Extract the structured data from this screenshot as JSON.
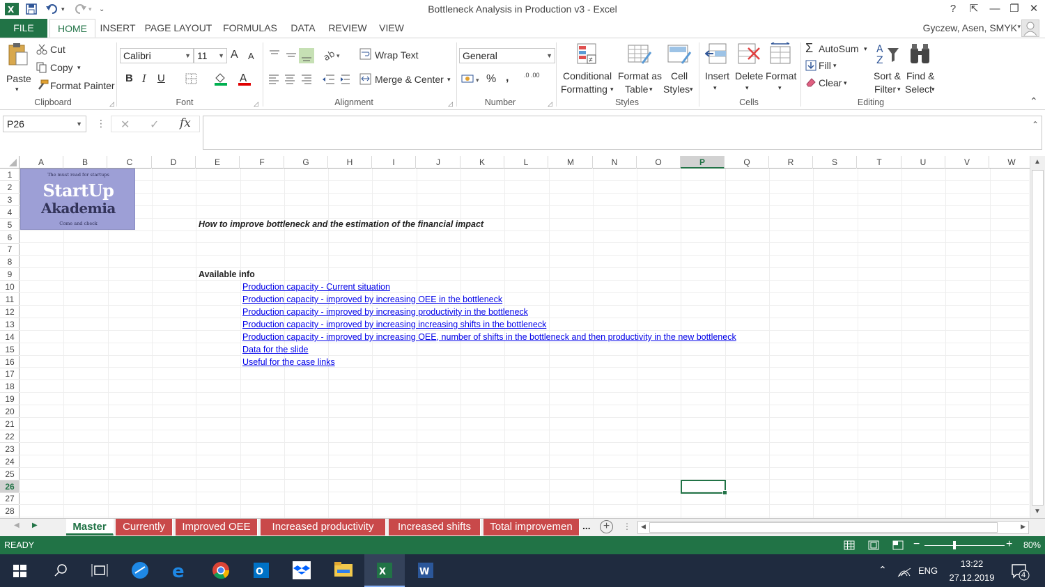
{
  "window": {
    "title": "Bottleneck Analysis in Production v3 - Excel",
    "help": "?",
    "ribbon_toggle": "⇱",
    "minimize": "—",
    "restore": "❐",
    "close": "✕"
  },
  "tabs": [
    "FILE",
    "HOME",
    "INSERT",
    "PAGE LAYOUT",
    "FORMULAS",
    "DATA",
    "REVIEW",
    "VIEW"
  ],
  "user": "Gyczew, Asen, SMYK",
  "ribbon": {
    "clipboard": {
      "paste": "Paste",
      "cut": "Cut",
      "copy": "Copy",
      "format_painter": "Format Painter",
      "label": "Clipboard"
    },
    "font": {
      "name": "Calibri",
      "size": "11",
      "bold": "B",
      "italic": "I",
      "underline": "U",
      "grow": "A",
      "shrink": "A",
      "label": "Font"
    },
    "alignment": {
      "wrap": "Wrap Text",
      "merge": "Merge & Center",
      "label": "Alignment"
    },
    "number": {
      "format": "General",
      "percent": "%",
      "comma": ",",
      "inc_dec": ".0 .00",
      "label": "Number"
    },
    "styles": {
      "conditional1": "Conditional",
      "conditional2": "Formatting",
      "format_as1": "Format as",
      "format_as2": "Table",
      "cell_styles1": "Cell",
      "cell_styles2": "Styles",
      "label": "Styles"
    },
    "cells": {
      "insert": "Insert",
      "delete": "Delete",
      "format": "Format",
      "label": "Cells"
    },
    "editing": {
      "autosum": "AutoSum",
      "fill": "Fill",
      "clear": "Clear",
      "sort1": "Sort &",
      "sort2": "Filter",
      "find1": "Find &",
      "find2": "Select",
      "label": "Editing"
    }
  },
  "formula_bar": {
    "name_box": "P26",
    "fx": "fx",
    "cancel": "✕",
    "enter": "✓",
    "content": ""
  },
  "columns": [
    "A",
    "B",
    "C",
    "D",
    "E",
    "F",
    "G",
    "H",
    "I",
    "J",
    "K",
    "L",
    "M",
    "N",
    "O",
    "P",
    "Q",
    "R",
    "S",
    "T",
    "U",
    "V",
    "W"
  ],
  "selected_column": "P",
  "rows": [
    "1",
    "2",
    "3",
    "4",
    "5",
    "6",
    "7",
    "8",
    "9",
    "10",
    "11",
    "12",
    "13",
    "14",
    "15",
    "16",
    "17",
    "18",
    "19",
    "20",
    "21",
    "22",
    "23",
    "24",
    "25",
    "26",
    "27",
    "28"
  ],
  "selected_row": "26",
  "logo": {
    "tagline_top": "The must read for startups",
    "line1": "StartUp",
    "line2": "Akademia",
    "tagline_bottom": "Come and check"
  },
  "sheet": {
    "heading": "How to improve bottleneck and the estimation of the financial impact",
    "available_info": "Available info",
    "links": [
      "Production capacity - Current situation",
      "Production capacity - improved by increasing OEE in the bottleneck",
      "Production capacity - improved by increasing productivity in the bottleneck",
      "Production capacity - improved by increasing increasing shifts in the bottleneck",
      "Production capacity - improved by increasing OEE, number of shifts in the bottleneck and then productivity in the new bottleneck",
      "Data for the slide",
      "Useful for the case links"
    ]
  },
  "sheet_tabs": [
    "Master",
    "Currently",
    "Improved OEE",
    "Increased productivity",
    "Increased shifts",
    "Total improvemen"
  ],
  "sheet_tabs_more": "...",
  "status": {
    "ready": "READY",
    "zoom": "80%"
  },
  "taskbar": {
    "lang": "ENG",
    "time": "13:22",
    "date": "27.12.2019",
    "notifications": "4"
  },
  "colors": {
    "excel_green": "#217346",
    "tab_red": "#c9494a",
    "link_blue": "#0000e8",
    "logo_bg": "#9d9fd6"
  }
}
